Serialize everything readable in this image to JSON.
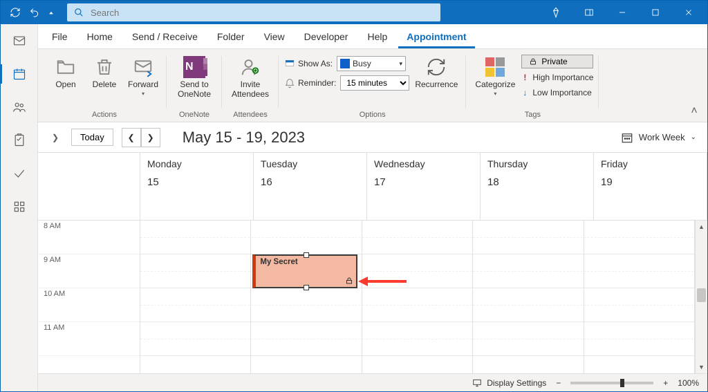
{
  "titlebar": {
    "search_placeholder": "Search"
  },
  "menubar": {
    "items": [
      "File",
      "Home",
      "Send / Receive",
      "Folder",
      "View",
      "Developer",
      "Help",
      "Appointment"
    ],
    "active": "Appointment"
  },
  "ribbon": {
    "actions": {
      "open": "Open",
      "delete": "Delete",
      "forward": "Forward",
      "group": "Actions"
    },
    "onenote": {
      "button": "Send to OneNote",
      "group": "OneNote"
    },
    "attendees": {
      "button": "Invite Attendees",
      "group": "Attendees"
    },
    "options": {
      "show_as_label": "Show As:",
      "show_as_value": "Busy",
      "reminder_label": "Reminder:",
      "reminder_value": "15 minutes",
      "recurrence": "Recurrence",
      "group": "Options"
    },
    "tags": {
      "categorize": "Categorize",
      "private": "Private",
      "high": "High Importance",
      "low": "Low Importance",
      "group": "Tags"
    }
  },
  "calendar_toolbar": {
    "today": "Today",
    "range": "May 15 - 19, 2023",
    "view": "Work Week"
  },
  "calendar": {
    "days": [
      {
        "dow": "Monday",
        "num": "15"
      },
      {
        "dow": "Tuesday",
        "num": "16"
      },
      {
        "dow": "Wednesday",
        "num": "17"
      },
      {
        "dow": "Thursday",
        "num": "18"
      },
      {
        "dow": "Friday",
        "num": "19"
      }
    ],
    "hours": [
      "8 AM",
      "9 AM",
      "10 AM",
      "11 AM"
    ],
    "event": {
      "title": "My Secret",
      "day": 1,
      "private": true
    }
  },
  "statusbar": {
    "display": "Display Settings",
    "zoom": "100%"
  }
}
